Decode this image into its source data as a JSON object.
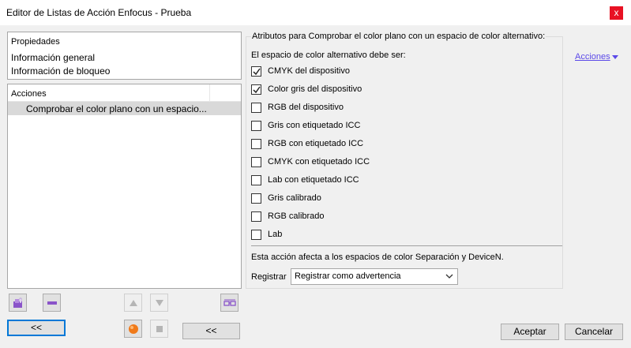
{
  "window": {
    "title": "Editor de Listas de Acción Enfocus - Prueba",
    "close_glyph": "x"
  },
  "properties": {
    "header": "Propiedades",
    "items": [
      "Información general",
      "Información de bloqueo"
    ]
  },
  "actions_list": {
    "header": "Acciones",
    "items": [
      "Comprobar el color plano con un espacio..."
    ]
  },
  "left_buttons": {
    "collapse_label": "<<",
    "collapse2_label": "<<"
  },
  "group": {
    "title": "Atributos para Comprobar el color plano con un espacio de color alternativo:",
    "subheader": "El espacio de color alternativo debe ser:",
    "actions_link": "Acciones",
    "checkboxes": [
      {
        "label": "CMYK del dispositivo",
        "checked": true
      },
      {
        "label": "Color gris del dispositivo",
        "checked": true
      },
      {
        "label": "RGB del dispositivo",
        "checked": false
      },
      {
        "label": "Gris con etiquetado ICC",
        "checked": false
      },
      {
        "label": "RGB con etiquetado ICC",
        "checked": false
      },
      {
        "label": "CMYK con etiquetado ICC",
        "checked": false
      },
      {
        "label": "Lab con etiquetado ICC",
        "checked": false
      },
      {
        "label": "Gris calibrado",
        "checked": false
      },
      {
        "label": "RGB calibrado",
        "checked": false
      },
      {
        "label": "Lab",
        "checked": false
      }
    ],
    "note": "Esta acción afecta a los espacios de color Separación y DeviceN.",
    "register_label": "Registrar",
    "register_value": "Registrar como advertencia"
  },
  "footer": {
    "accept_label": "Aceptar",
    "cancel_label": "Cancelar"
  },
  "colors": {
    "link": "#5b49e8",
    "close_bg": "#e81123",
    "selection": "#d9d9d9"
  }
}
